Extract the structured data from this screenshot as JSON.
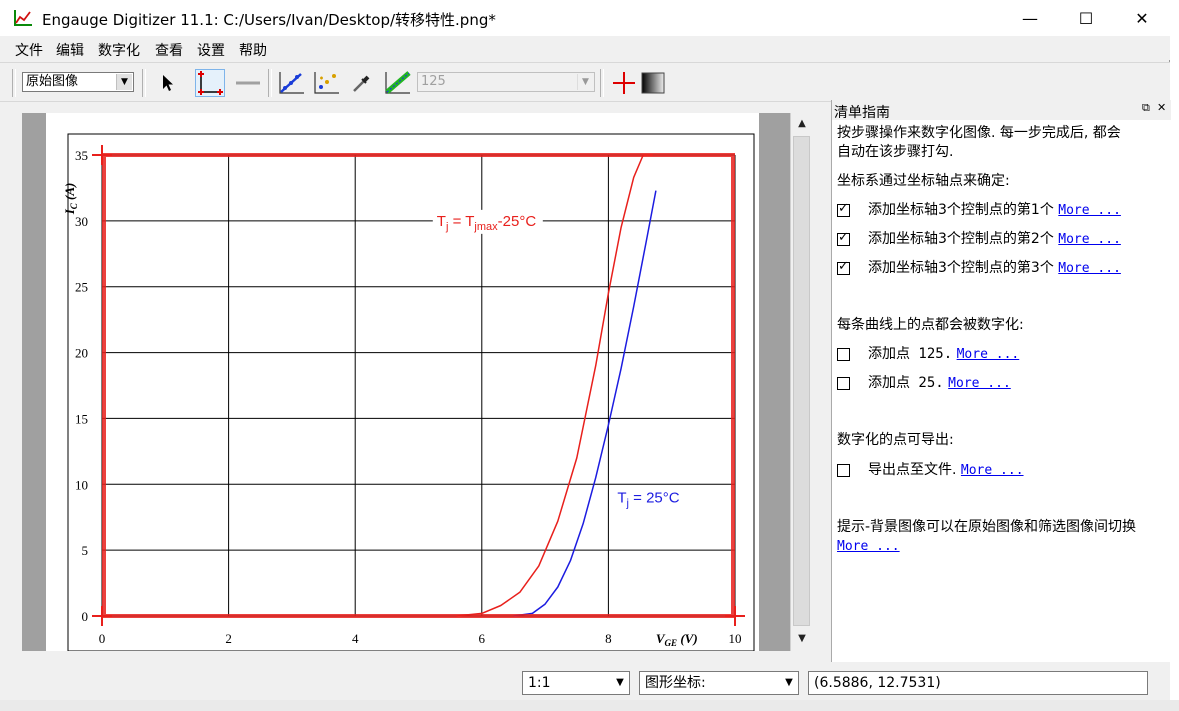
{
  "window": {
    "title": "Engauge Digitizer 11.1: C:/Users/Ivan/Desktop/转移特性.png*",
    "minimize": "—",
    "maximize": "☐",
    "close": "✕"
  },
  "menu": [
    "文件",
    "编辑",
    "数字化",
    "查看",
    "设置",
    "帮助"
  ],
  "toolbar": {
    "background_select": "原始图像",
    "curve_select": "125"
  },
  "chart_data": {
    "type": "line",
    "x_ticks": [
      "0",
      "2",
      "4",
      "6",
      "8",
      "10"
    ],
    "y_ticks": [
      "0",
      "5",
      "10",
      "15",
      "20",
      "25",
      "30",
      "35"
    ],
    "xlim": [
      0,
      10
    ],
    "ylim": [
      0,
      35
    ],
    "xlabel": "V",
    "xlabel_sub": "GE",
    "xlabel_unit": "(V)",
    "ylabel": "I",
    "ylabel_sub": "C",
    "ylabel_unit": "(A)",
    "grid": true,
    "series": [
      {
        "name": "Tj = Tjmax-25°C",
        "color": "#e8201c",
        "x": [
          5.6,
          6.0,
          6.3,
          6.6,
          6.9,
          7.2,
          7.5,
          7.8,
          8.0,
          8.2,
          8.4,
          8.55,
          8.7
        ],
        "y": [
          0,
          0.2,
          0.8,
          1.8,
          3.8,
          7.2,
          12.0,
          19.0,
          24.5,
          29.5,
          33.3,
          35,
          35
        ]
      },
      {
        "name": "Tj = 25°C",
        "color": "#1c1ce0",
        "x": [
          6.5,
          6.8,
          7.0,
          7.2,
          7.4,
          7.6,
          7.8,
          8.0,
          8.2,
          8.4,
          8.6,
          8.75
        ],
        "y": [
          0,
          0.2,
          0.9,
          2.2,
          4.2,
          7.0,
          10.5,
          14.5,
          18.8,
          23.5,
          28.5,
          32.3
        ]
      }
    ],
    "annotations": [
      {
        "text_main": "T",
        "sub1": "j",
        "mid": " = T",
        "sub2": "jmax",
        "tail": "-25°C",
        "color": "#e8201c"
      },
      {
        "text_main": "T",
        "sub1": "j",
        "mid": " = 25°C",
        "sub2": "",
        "tail": "",
        "color": "#1c1ce0"
      }
    ],
    "axis_markers_color": "#e8201c"
  },
  "panel": {
    "title": "清单指南",
    "float_icon": "⧉",
    "close_icon": "✕",
    "intro_line1": "按步骤操作来数字化图像. 每一步完成后, 都会",
    "intro_line2": "自动在该步骤打勾.",
    "axes_heading": "坐标系通过坐标轴点来确定:",
    "axis_items": [
      {
        "label": "添加坐标轴3个控制点的第1个",
        "more": "More ...",
        "checked": true
      },
      {
        "label": "添加坐标轴3个控制点的第2个",
        "more": "More ...",
        "checked": true
      },
      {
        "label": "添加坐标轴3个控制点的第3个",
        "more": "More ...",
        "checked": true
      }
    ],
    "curves_heading": "每条曲线上的点都会被数字化:",
    "curve_items": [
      {
        "label": "添加点 125.",
        "more": "More ...",
        "checked": false
      },
      {
        "label": "添加点 25.",
        "more": "More ...",
        "checked": false
      }
    ],
    "export_heading": "数字化的点可导出:",
    "export_item": {
      "label": "导出点至文件.",
      "more": "More ...",
      "checked": false
    },
    "tip_line1": "提示-背景图像可以在原始图像和筛选图像间切换",
    "tip_more": "More ..."
  },
  "status": {
    "zoom": "1:1",
    "coord_mode": "图形坐标:",
    "coords": "(6.5886, 12.7531)"
  }
}
